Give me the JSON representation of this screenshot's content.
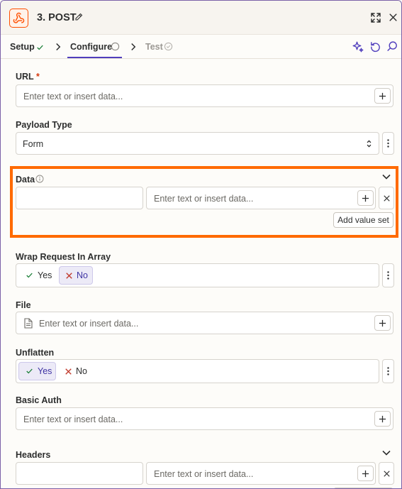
{
  "header": {
    "title": "3. POST",
    "app_icon": "webhook-icon",
    "brand_color": "#ff4f00"
  },
  "tabs": [
    {
      "label": "Setup",
      "status": "complete"
    },
    {
      "label": "Configure",
      "status": "active"
    },
    {
      "label": "Test",
      "status": "pending"
    }
  ],
  "fields": {
    "url": {
      "label": "URL",
      "required_mark": "*",
      "placeholder": "Enter text or insert data..."
    },
    "payload_type": {
      "label": "Payload Type",
      "value": "Form"
    },
    "data": {
      "label": "Data",
      "key_placeholder": "",
      "value_placeholder": "Enter text or insert data...",
      "add_button": "Add value set"
    },
    "wrap_request": {
      "label": "Wrap Request In Array",
      "yes": "Yes",
      "no": "No",
      "selected": "No"
    },
    "file": {
      "label": "File",
      "placeholder": "Enter text or insert data..."
    },
    "unflatten": {
      "label": "Unflatten",
      "yes": "Yes",
      "no": "No",
      "selected": "Yes"
    },
    "basic_auth": {
      "label": "Basic Auth",
      "placeholder": "Enter text or insert data..."
    },
    "headers": {
      "label": "Headers",
      "value_placeholder": "Enter text or insert data..."
    }
  },
  "colors": {
    "accent": "#503ebd",
    "highlight": "#ff6a00"
  }
}
